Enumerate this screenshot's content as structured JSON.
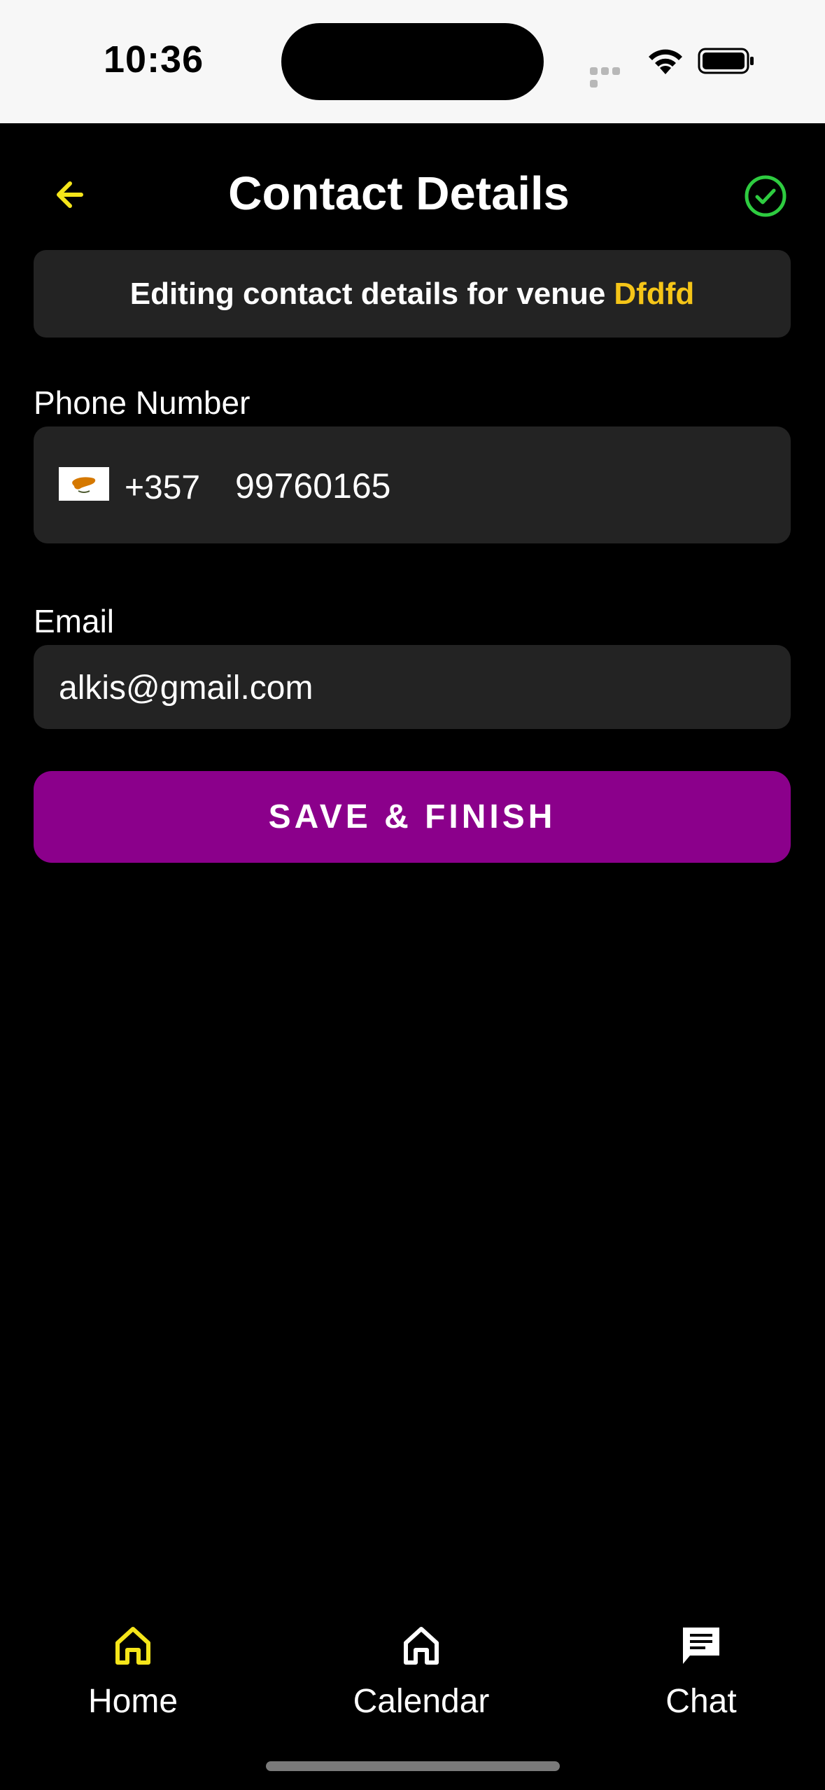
{
  "status_bar": {
    "time": "10:36"
  },
  "header": {
    "title": "Contact Details"
  },
  "banner": {
    "prefix": "Editing contact details for venue",
    "venue_name": "Dfdfd"
  },
  "phone": {
    "label": "Phone Number",
    "country_code": "+357",
    "number": "99760165",
    "flag_icon": "cyprus-flag-icon"
  },
  "email": {
    "label": "Email",
    "value": "alkis@gmail.com"
  },
  "save_button": {
    "label": "SAVE & FINISH"
  },
  "tabs": [
    {
      "label": "Home",
      "icon": "home-icon",
      "active": true
    },
    {
      "label": "Calendar",
      "icon": "home-icon",
      "active": false
    },
    {
      "label": "Chat",
      "icon": "chat-icon",
      "active": false
    }
  ],
  "colors": {
    "accent": "#f5c518",
    "primary_button": "#8b008b",
    "success": "#2ecc40",
    "background": "#000000",
    "field": "#232323"
  }
}
